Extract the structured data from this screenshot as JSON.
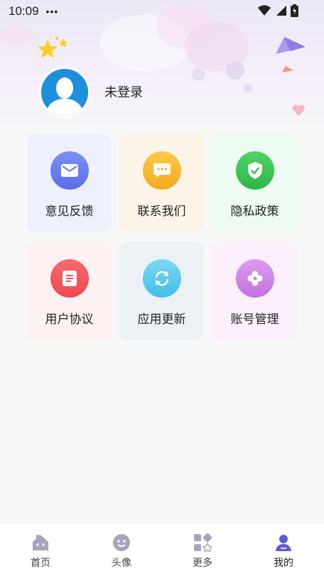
{
  "status_bar": {
    "time": "10:09",
    "dots": "•••"
  },
  "profile": {
    "login_text": "未登录"
  },
  "menu": {
    "items": [
      {
        "label": "意见反馈",
        "icon": "mail-icon",
        "bg": "#eef0fd",
        "circle": "#6a7bf0"
      },
      {
        "label": "联系我们",
        "icon": "chat-icon",
        "bg": "#fdf4e8",
        "circle": "#f7b22c"
      },
      {
        "label": "隐私政策",
        "icon": "shield-check-icon",
        "bg": "#eefbf0",
        "circle": "#35c456"
      },
      {
        "label": "用户协议",
        "icon": "document-icon",
        "bg": "#fdf2f1",
        "circle": "#f2575b"
      },
      {
        "label": "应用更新",
        "icon": "refresh-icon",
        "bg": "#ebf1f4",
        "circle": "#56c9ef"
      },
      {
        "label": "账号管理",
        "icon": "flower-icon",
        "bg": "#fbf0fc",
        "circle": "#cf85e6"
      }
    ]
  },
  "tabbar": {
    "tabs": [
      {
        "label": "首页",
        "icon": "home-icon"
      },
      {
        "label": "头像",
        "icon": "face-icon"
      },
      {
        "label": "更多",
        "icon": "grid-icon"
      },
      {
        "label": "我的",
        "icon": "user-icon",
        "active": true
      }
    ],
    "active_color": "#5b5bd6",
    "inactive_color": "#a8a4be"
  }
}
